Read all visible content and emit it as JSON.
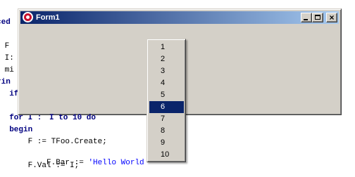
{
  "code_editor": {
    "lines": [
      {
        "a": "",
        "b": "'"
      },
      {
        "a": "",
        "b": "ced"
      },
      {
        "a": "",
        "b": ""
      },
      {
        "a": "",
        "b": " F"
      },
      {
        "a": "",
        "b": " I:"
      },
      {
        "a": "",
        "b": " mi"
      },
      {
        "a": "",
        "b": "rin"
      },
      {
        "a": "",
        "b": "  if"
      },
      {
        "a": "",
        "b": ""
      },
      {
        "a": "",
        "b": "  for I : "
      },
      {
        "a": "",
        "b": "  begin"
      },
      {
        "a": "",
        "b": "      F := TFoo.Create;"
      },
      {
        "a": "",
        "b": "      F.Bar := 'Hello World"
      },
      {
        "a": "",
        "b": "      F.Val := I;"
      }
    ],
    "partial_for": "I to 10 do"
  },
  "window": {
    "title": "Form1",
    "minimize_glyph": "_",
    "maximize_glyph": "□",
    "close_glyph": "×"
  },
  "popup": {
    "items": [
      "1",
      "2",
      "3",
      "4",
      "5",
      "6",
      "7",
      "8",
      "9",
      "10"
    ],
    "selected_index": 5
  },
  "colors": {
    "title_start": "#0a246a",
    "title_end": "#a6caf0",
    "face": "#d4d0c8",
    "selection": "#0a246a"
  }
}
